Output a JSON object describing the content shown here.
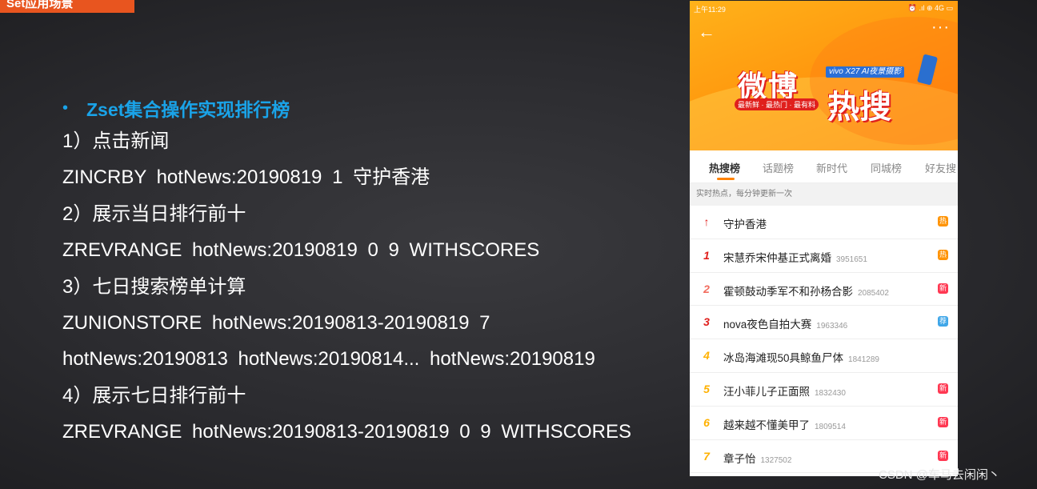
{
  "slide": {
    "corner_title": "Set应用场景",
    "bullet": "Zset集合操作实现排行榜",
    "lines": [
      "1）点击新闻",
      "ZINCRBY  hotNews:20190819  1  守护香港",
      "2）展示当日排行前十",
      "ZREVRANGE  hotNews:20190819  0  9  WITHSCORES",
      "3）七日搜索榜单计算",
      "ZUNIONSTORE  hotNews:20190813-20190819  7",
      "hotNews:20190813  hotNews:20190814... hotNews:20190819",
      "4）展示七日排行前十",
      "ZREVRANGE hotNews:20190813-20190819  0  9  WITHSCORES"
    ]
  },
  "phone": {
    "status_time": "上午11:29",
    "status_icons": "⏰ .ıl ⊕ 4G ▭",
    "logo": {
      "weibo": "微博",
      "resou": "热搜",
      "vivo": "vivo X27 AI夜景摄影",
      "slogan": "最新鲜 · 最热门 · 最有料"
    },
    "tabs": [
      "热搜榜",
      "话题榜",
      "新时代",
      "同城榜",
      "好友搜"
    ],
    "banner": "实时热点，每分钟更新一次",
    "items": [
      {
        "rank": "↑",
        "title": "守护香港",
        "count": "",
        "badge": "热",
        "badge_color": "#ff9406",
        "rank_color": "#e0201d"
      },
      {
        "rank": "1",
        "title": "宋慧乔宋仲基正式离婚",
        "count": "3951651",
        "badge": "热",
        "badge_color": "#ff9406",
        "rank_color": "#e0201d"
      },
      {
        "rank": "2",
        "title": "霍顿鼓动季军不和孙杨合影",
        "count": "2085402",
        "badge": "新",
        "badge_color": "#ff3852",
        "rank_color": "#f26d5f"
      },
      {
        "rank": "3",
        "title": "nova夜色自拍大赛",
        "count": "1963346",
        "badge": "荐",
        "badge_color": "#3fa6e8",
        "rank_color": "#e0201d"
      },
      {
        "rank": "4",
        "title": "冰岛海滩现50具鲸鱼尸体",
        "count": "1841289",
        "badge": "",
        "badge_color": "",
        "rank_color": "#ffb100"
      },
      {
        "rank": "5",
        "title": "汪小菲儿子正面照",
        "count": "1832430",
        "badge": "新",
        "badge_color": "#ff3852",
        "rank_color": "#ffb100"
      },
      {
        "rank": "6",
        "title": "越来越不懂美甲了",
        "count": "1809514",
        "badge": "新",
        "badge_color": "#ff3852",
        "rank_color": "#ffb100"
      },
      {
        "rank": "7",
        "title": "章子怡",
        "count": "1327502",
        "badge": "新",
        "badge_color": "#ff3852",
        "rank_color": "#ffb100"
      }
    ]
  },
  "watermark": "CSDN @车马去闲闲丶"
}
